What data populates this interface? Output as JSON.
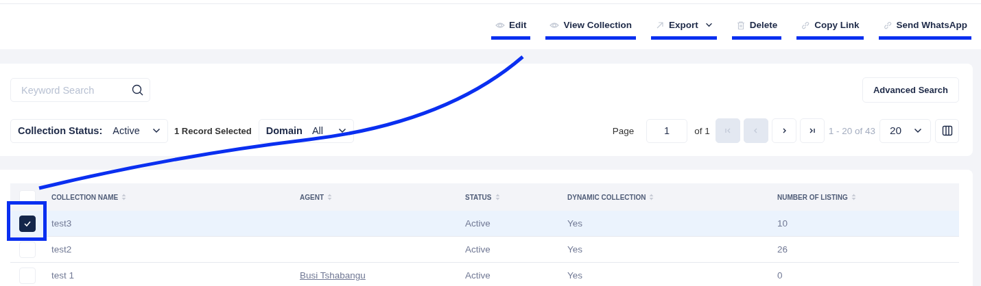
{
  "actions": [
    {
      "label": "Edit",
      "has_menu": false,
      "underlined": true
    },
    {
      "label": "View Collection",
      "has_menu": false,
      "underlined": true
    },
    {
      "label": "Export",
      "has_menu": true,
      "underlined": true
    },
    {
      "label": "Delete",
      "has_menu": false,
      "underlined": true
    },
    {
      "label": "Copy Link",
      "has_menu": false,
      "underlined": true
    },
    {
      "label": "Send WhatsApp",
      "has_menu": false,
      "underlined": true
    }
  ],
  "search": {
    "placeholder": "Keyword Search"
  },
  "advanced_search": "Advanced Search",
  "status_filter": {
    "label": "Collection Status:",
    "value": "Active"
  },
  "selection_count": "1 Record Selected",
  "domain_filter": {
    "label": "Domain",
    "value": "All"
  },
  "pagination": {
    "page_label": "Page",
    "page": "1",
    "of": "of 1",
    "buttons": [
      {
        "disabled": true
      },
      {
        "disabled": true
      },
      {
        "disabled": false
      },
      {
        "disabled": false
      }
    ],
    "range": "1 - 20 of 43",
    "page_size": "20"
  },
  "table": {
    "select_all": {
      "checked": false
    },
    "columns": [
      "COLLECTION NAME",
      "AGENT",
      "STATUS",
      "DYNAMIC COLLECTION",
      "NUMBER OF LISTING"
    ],
    "rows": [
      {
        "selected": true,
        "highlighted": true,
        "cells": [
          "test3",
          "",
          "Active",
          "Yes",
          "10"
        ]
      },
      {
        "selected": false,
        "highlighted": false,
        "cells": [
          "test2",
          "",
          "Active",
          "Yes",
          "26"
        ]
      },
      {
        "selected": false,
        "highlighted": false,
        "cells": [
          "test 1",
          "Busi Tshabangu",
          "Active",
          "Yes",
          "0"
        ]
      }
    ]
  }
}
